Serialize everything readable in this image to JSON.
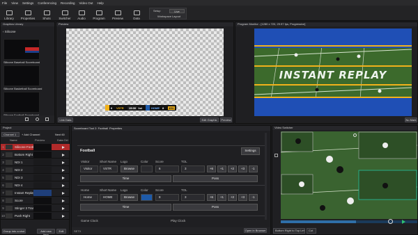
{
  "menu": [
    "File",
    "View",
    "Settings",
    "Conferencing",
    "Recording",
    "Video Out",
    "Help"
  ],
  "toolbar": {
    "items": [
      "Library",
      "Properties",
      "Shots",
      "Switcher",
      "Audio",
      "Program",
      "Preview",
      "Data"
    ],
    "setup_label": "Setup",
    "live_label": "Live",
    "workspace_label": "Workspace Layout"
  },
  "library": {
    "title": "Graphics Library",
    "breadcrumb": "Silicone",
    "items": [
      "Silicone Baseball Scoreboard",
      "Silicone Basketball Scoreboard",
      "Silicone Football Scoreboard"
    ]
  },
  "preview": {
    "title": "Preview",
    "left_btn": "Link Data",
    "right_btn1": "Edit Graphic",
    "right_btn2": "Preview",
    "scoreboard": {
      "visitor": "VSTR",
      "visitor_score": "6",
      "clock": "15:00",
      "period": "1st",
      "home": "HOME",
      "home_score": "8",
      "down": "3RD"
    }
  },
  "program": {
    "title": "Program Monitor - [1280 x 720, 29.97 fps, Progressive]",
    "replay_text": "INSTANT REPLAY",
    "btn": "No Mark"
  },
  "project": {
    "title": "Project",
    "channel": "Channel 1",
    "add_channel": "+ Add Channel",
    "columns": [
      "Name",
      "Preview",
      "Data Ctrl"
    ],
    "rows": [
      {
        "num": "1",
        "name": "Silicone Footbal..."
      },
      {
        "num": "2",
        "name": "Bottom Right S..."
      },
      {
        "num": "3",
        "name": "NDI 1"
      },
      {
        "num": "4",
        "name": "NDI 2"
      },
      {
        "num": "5",
        "name": "NDI 3"
      },
      {
        "num": "6",
        "name": "NDI 4"
      },
      {
        "num": "7",
        "name": "Instant Replay"
      },
      {
        "num": "8",
        "name": "Score"
      },
      {
        "num": "9",
        "name": "Stinger 3 Transi..."
      },
      {
        "num": "10",
        "name": "Push Right"
      }
    ],
    "footer": [
      "Group into a shot",
      "Add new item",
      "Edit"
    ],
    "next_label": "Next 60"
  },
  "properties": {
    "tabs": [
      "Scoreboard Tool 2: Football",
      "Properties"
    ],
    "section_title": "Football",
    "settings_btn": "Settings",
    "headers": [
      "Short Name",
      "Logo",
      "Color",
      "Score",
      "TOL"
    ],
    "visitor": {
      "label": "Visitor",
      "name": "Visitor",
      "short": "VSTR",
      "logo": "Browse",
      "score": "6",
      "tol": "3",
      "color": "#2b2b2f"
    },
    "home": {
      "label": "Home",
      "name": "Home",
      "short": "HOME",
      "logo": "Browse",
      "score": "8",
      "tol": "3",
      "color": "#1e5aa8"
    },
    "adjust": [
      "+6",
      "+1",
      "+2",
      "+3",
      "-1"
    ],
    "time_btn": "Time",
    "poss_btn": "Poss",
    "game_clock": "Game Clock",
    "play_clock": "Play Clock",
    "footer_label": "SETX",
    "open_browser": "Open in Browser"
  },
  "switcher": {
    "title": "Video Switcher",
    "transition": "Bottom Right to Top Left",
    "cut": "Cut"
  }
}
